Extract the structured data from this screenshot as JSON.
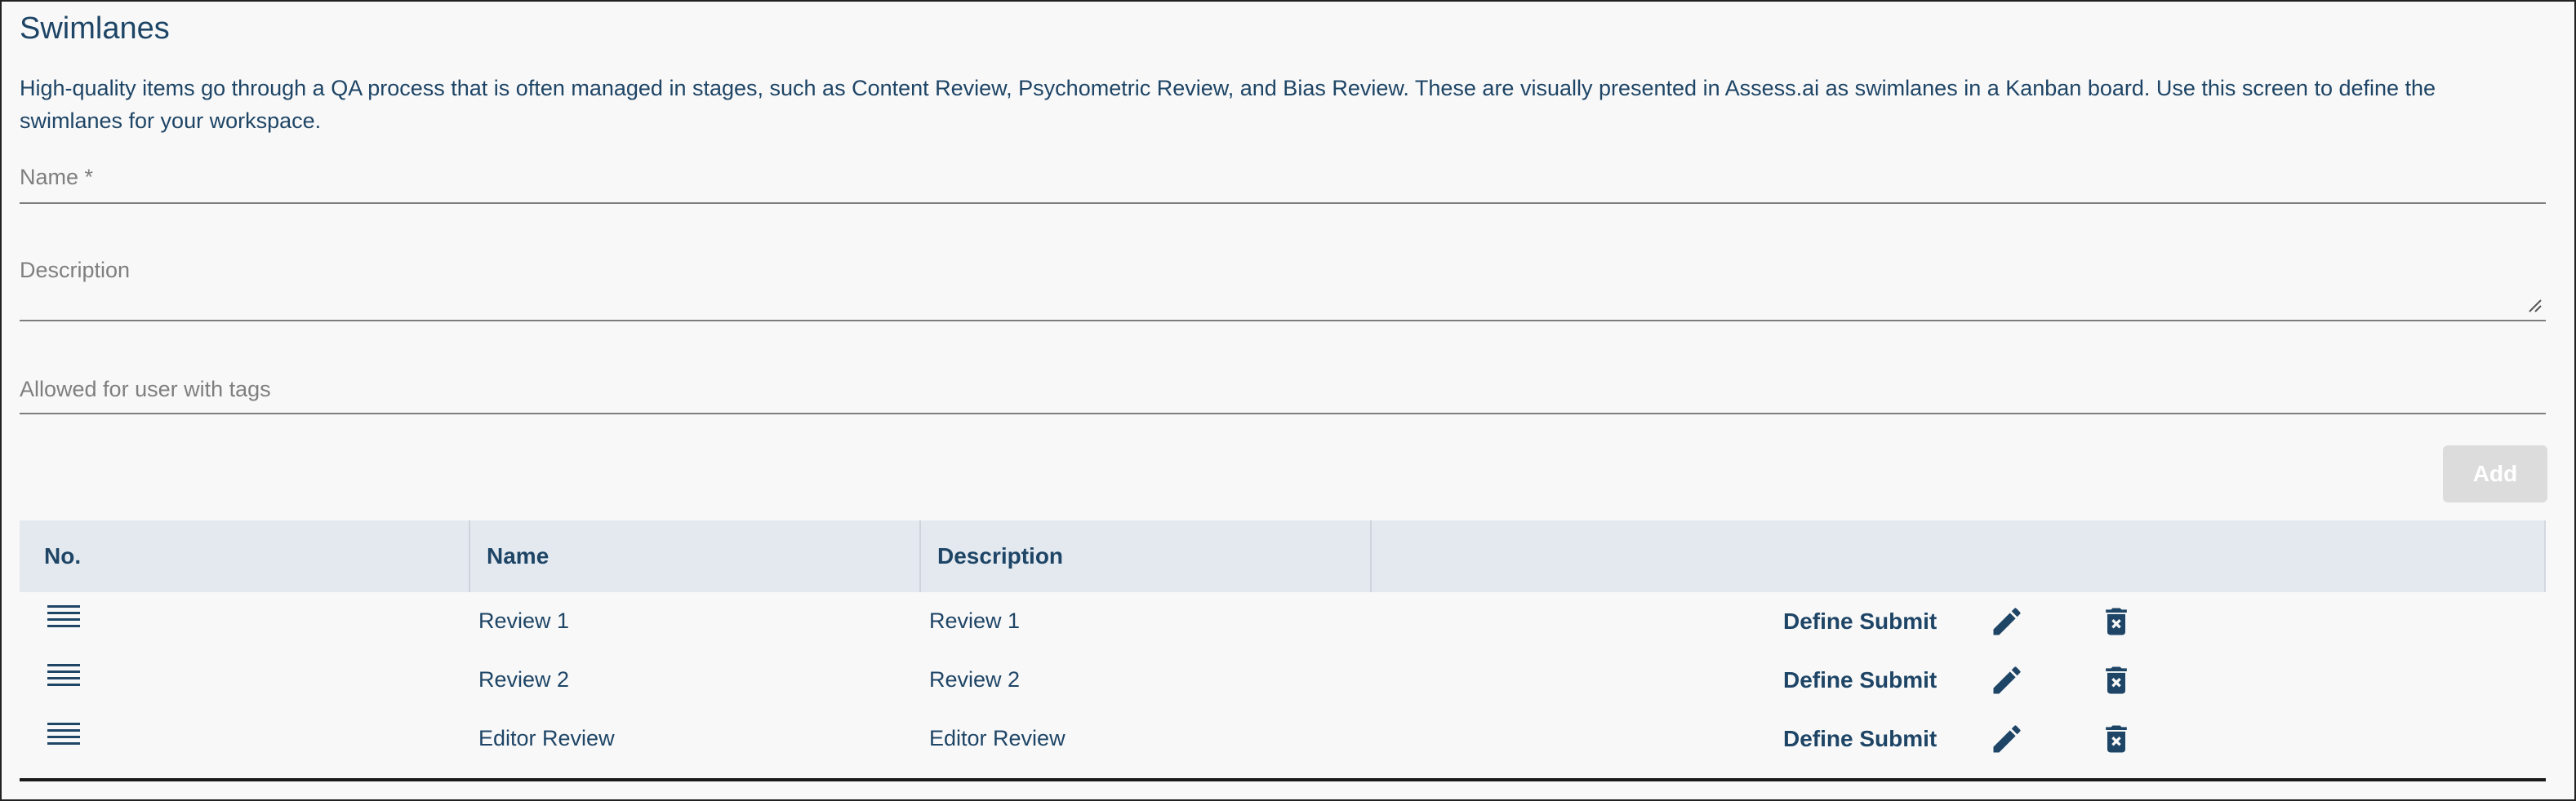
{
  "page": {
    "title": "Swimlanes",
    "intro": "High-quality items go through a QA process that is often managed in stages, such as Content Review, Psychometric Review, and Bias Review. These are visually presented in Assess.ai as swimlanes in a Kanban board. Use this screen to define the swimlanes for your workspace."
  },
  "form": {
    "name_label": "Name *",
    "name_value": "",
    "description_label": "Description",
    "description_value": "",
    "tags_label": "Allowed for user with tags",
    "tags_value": "",
    "add_label": "Add",
    "add_enabled": false
  },
  "table": {
    "headers": [
      "No.",
      "Name",
      "Description",
      ""
    ],
    "rows": [
      {
        "name": "Review 1",
        "description": "Review 1",
        "action_label": "Define Submit"
      },
      {
        "name": "Review 2",
        "description": "Review 2",
        "action_label": "Define Submit"
      },
      {
        "name": "Editor Review",
        "description": "Editor Review",
        "action_label": "Define Submit"
      }
    ]
  },
  "icons": {
    "drag": "drag-handle-icon",
    "edit": "pencil-icon",
    "delete": "trash-icon"
  },
  "colors": {
    "primary_text": "#1e4566",
    "header_bg": "#e4e9f0",
    "disabled_button": "#dcdcdc"
  }
}
